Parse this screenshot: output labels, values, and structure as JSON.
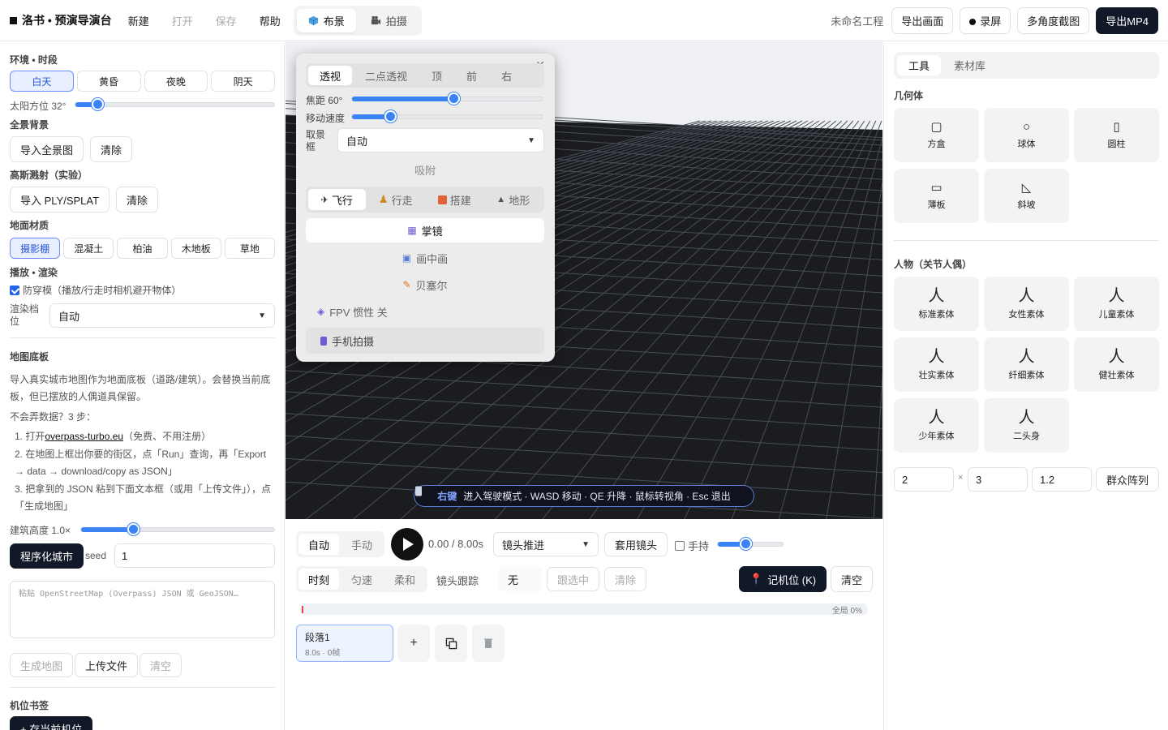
{
  "topbar": {
    "brand": "洛书 • 预演导演台",
    "menu": [
      "新建",
      "打开",
      "保存",
      "帮助"
    ],
    "modes": [
      {
        "icon": "cube-icon",
        "label": "布景"
      },
      {
        "icon": "camera-icon",
        "label": "拍摄"
      }
    ],
    "project_name": "未命名工程",
    "export_frame": "导出画面",
    "record": "录屏",
    "multi_screenshot": "多角度截图",
    "export_mp4": "导出MP4"
  },
  "left": {
    "env_title": "环境 • 时段",
    "env_options": [
      "白天",
      "黄昏",
      "夜晚",
      "阴天"
    ],
    "sun_label": "太阳方位 32°",
    "sun_value": 0.11,
    "pano_title": "全景背景",
    "import_pano": "导入全景图",
    "clear": "清除",
    "gs_title": "高斯溅射（实验）",
    "import_ply": "导入 PLY/SPLAT",
    "ground_title": "地面材质",
    "ground_options": [
      "摄影棚",
      "混凝土",
      "柏油",
      "木地板",
      "草地"
    ],
    "playback_title": "播放 • 渲染",
    "anti_clip": "防穿模（播放/行走时相机避开物体）",
    "render_label": "渲染档位",
    "render_value": "自动",
    "map_title": "地图底板",
    "map_desc": "导入真实城市地图作为地面底板（道路/建筑）。会替换当前底板，但已摆放的人偶道具保留。",
    "map_q": "不会弄数据？3 步：",
    "step1_prefix": "1. 打开",
    "step1_link": "overpass-turbo.eu",
    "step1_suffix": "（免费、不用注册）",
    "step2": "2. 在地图上框出你要的街区，点「Run」查询，再「Export → data → download/copy as JSON」",
    "step3": "3. 把拿到的 JSON 粘到下面文本框（或用「上传文件」），点「生成地图」",
    "building_label": "建筑高度 1.0×",
    "building_value": 0.27,
    "proc_city": "程序化城市",
    "seed_label": "seed",
    "seed_value": "1",
    "textarea_placeholder": "粘贴 OpenStreetMap (Overpass) JSON 或 GeoJSON…",
    "gen_map": "生成地图",
    "upload": "上传文件",
    "clear2": "清空",
    "bookmark_title": "机位书签",
    "save_cam": "+ 存当前机位"
  },
  "popup": {
    "views": [
      "透视",
      "二点透视",
      "顶",
      "前",
      "右"
    ],
    "focal_label": "焦距 60°",
    "focal_value": 0.53,
    "speed_label": "移动速度",
    "speed_value": 0.2,
    "frame_label": "取景框",
    "frame_value": "自动",
    "snap": "吸附",
    "move_modes": [
      "飞行",
      "行走",
      "搭建",
      "地形"
    ],
    "director_view": "掌镜",
    "pip": "画中画",
    "bezier": "贝塞尔",
    "fpv": "FPV 惯性 关",
    "phone": "手机拍摄"
  },
  "viewport": {
    "hint_key": "右键",
    "hint_text": "进入驾驶模式 · WASD 移动 · QE 升降 · 鼠标转视角 · Esc 退出"
  },
  "timeline": {
    "mode_tabs": [
      "自动",
      "手动"
    ],
    "time": "0.00 / 8.00s",
    "shot_select": "镜头推进",
    "apply_shot": "套用镜头",
    "handheld": "手持",
    "handheld_value": 0.42,
    "interp_tabs": [
      "时刻",
      "匀速",
      "柔和"
    ],
    "follow_label": "镜头跟踪",
    "follow_value": "无",
    "follow_selected": "跟选中",
    "clear_follow": "清除",
    "keyframe": "记机位 (K)",
    "clear_all": "清空",
    "global_progress": "全局 0%",
    "progress_value": 0,
    "clip_name": "段落1",
    "clip_meta": "8.0s · 0帧"
  },
  "right": {
    "tabs": [
      "工具",
      "素材库"
    ],
    "geo_title": "几何体",
    "geometry": [
      {
        "icon": "box-icon",
        "label": "方盒"
      },
      {
        "icon": "sphere-icon",
        "label": "球体"
      },
      {
        "icon": "cylinder-icon",
        "label": "圆柱"
      },
      {
        "icon": "plate-icon",
        "label": "薄板"
      },
      {
        "icon": "ramp-icon",
        "label": "斜坡"
      }
    ],
    "people_title": "人物（关节人偶）",
    "people": [
      "标准素体",
      "女性素体",
      "儿童素体",
      "壮实素体",
      "纤细素体",
      "健壮素体",
      "少年素体",
      "二头身"
    ],
    "array_x": "2",
    "array_y": "3",
    "array_gap": "1.2",
    "crowd_array": "群众阵列"
  }
}
